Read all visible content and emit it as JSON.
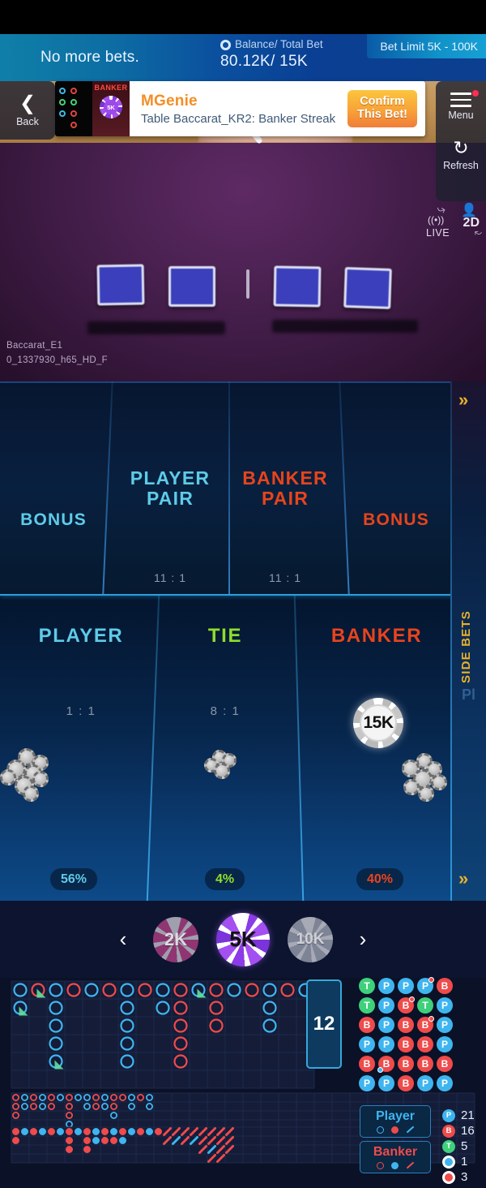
{
  "status": {
    "message": "No more bets.",
    "balance_label": "Balance/ Total Bet",
    "balance_value": "80.12K/ 15K",
    "bet_limit": "Bet Limit  5K - 100K"
  },
  "promo": {
    "title": "MGenie",
    "subtitle": "Table Baccarat_KR2: Banker Streak",
    "cta_line1": "Confirm",
    "cta_line2": "This Bet!",
    "thumb_badge": "BANKER",
    "thumb_chip": "5K"
  },
  "controls": {
    "back": "Back",
    "menu": "Menu",
    "refresh": "Refresh"
  },
  "video": {
    "stream_name": "Baccarat_E1",
    "stream_id": "0_1337930_h65_HD_F",
    "live": "LIVE",
    "view_mode": "2D"
  },
  "side_bets": {
    "tab_label": "SIDE BETS",
    "ghost_label": "Pl",
    "chevron": "»",
    "areas": [
      {
        "name": "BONUS",
        "color": "#5ecbe8",
        "odds": ""
      },
      {
        "name": "PLAYER\nPAIR",
        "color": "#5ecbe8",
        "odds": "11 : 1"
      },
      {
        "name": "BANKER\nPAIR",
        "color": "#e8441c",
        "odds": "11 : 1"
      },
      {
        "name": "BONUS",
        "color": "#e8441c",
        "odds": ""
      }
    ]
  },
  "main_bets": [
    {
      "name": "PLAYER",
      "color": "#5ecbe8",
      "odds": "1 : 1",
      "percent": "56%",
      "has_bet_chip": false
    },
    {
      "name": "TIE",
      "color": "#8ede2b",
      "odds": "8 : 1",
      "percent": "4%",
      "has_bet_chip": false
    },
    {
      "name": "BANKER",
      "color": "#e8441c",
      "odds": "",
      "percent": "40%",
      "has_bet_chip": true
    }
  ],
  "bet_chip": {
    "value": "15K"
  },
  "chip_selector": {
    "prev": "‹",
    "next": "›",
    "chips": [
      {
        "label": "2K",
        "selected": false,
        "style": "pink"
      },
      {
        "label": "5K",
        "selected": true,
        "style": "purple"
      },
      {
        "label": "10K",
        "selected": false,
        "style": "grey"
      }
    ]
  },
  "roadmaps": {
    "big_road_count": "12",
    "big_road": [
      {
        "col": 0,
        "row": 0,
        "t": "P"
      },
      {
        "col": 0,
        "row": 1,
        "t": "P",
        "bp": true
      },
      {
        "col": 1,
        "row": 0,
        "t": "B",
        "bp": true
      },
      {
        "col": 2,
        "row": 0,
        "t": "P"
      },
      {
        "col": 2,
        "row": 1,
        "t": "P"
      },
      {
        "col": 2,
        "row": 2,
        "t": "P"
      },
      {
        "col": 2,
        "row": 3,
        "t": "P"
      },
      {
        "col": 2,
        "row": 4,
        "t": "P",
        "bp": true
      },
      {
        "col": 3,
        "row": 0,
        "t": "B"
      },
      {
        "col": 4,
        "row": 0,
        "t": "P"
      },
      {
        "col": 5,
        "row": 0,
        "t": "B"
      },
      {
        "col": 6,
        "row": 0,
        "t": "P"
      },
      {
        "col": 6,
        "row": 1,
        "t": "P"
      },
      {
        "col": 6,
        "row": 2,
        "t": "P"
      },
      {
        "col": 6,
        "row": 3,
        "t": "P"
      },
      {
        "col": 6,
        "row": 4,
        "t": "P"
      },
      {
        "col": 7,
        "row": 0,
        "t": "B"
      },
      {
        "col": 8,
        "row": 0,
        "t": "P"
      },
      {
        "col": 8,
        "row": 1,
        "t": "P"
      },
      {
        "col": 9,
        "row": 0,
        "t": "B"
      },
      {
        "col": 9,
        "row": 1,
        "t": "B"
      },
      {
        "col": 9,
        "row": 2,
        "t": "B"
      },
      {
        "col": 9,
        "row": 3,
        "t": "B"
      },
      {
        "col": 9,
        "row": 4,
        "t": "B"
      },
      {
        "col": 10,
        "row": 0,
        "t": "P",
        "bp": true
      },
      {
        "col": 11,
        "row": 0,
        "t": "B"
      },
      {
        "col": 11,
        "row": 1,
        "t": "B"
      },
      {
        "col": 11,
        "row": 2,
        "t": "B"
      },
      {
        "col": 12,
        "row": 0,
        "t": "P"
      },
      {
        "col": 13,
        "row": 0,
        "t": "B"
      },
      {
        "col": 14,
        "row": 0,
        "t": "P"
      },
      {
        "col": 14,
        "row": 1,
        "t": "P"
      },
      {
        "col": 14,
        "row": 2,
        "t": "P"
      },
      {
        "col": 15,
        "row": 0,
        "t": "B"
      },
      {
        "col": 16,
        "row": 0,
        "t": "P"
      }
    ],
    "big_eye": [
      {
        "c": 0,
        "r": 0,
        "t": "B"
      },
      {
        "c": 0,
        "r": 1,
        "t": "B"
      },
      {
        "c": 0,
        "r": 2,
        "t": "B"
      },
      {
        "c": 1,
        "r": 0,
        "t": "P"
      },
      {
        "c": 1,
        "r": 1,
        "t": "P"
      },
      {
        "c": 2,
        "r": 0,
        "t": "B"
      },
      {
        "c": 2,
        "r": 1,
        "t": "B"
      },
      {
        "c": 3,
        "r": 0,
        "t": "P"
      },
      {
        "c": 3,
        "r": 1,
        "t": "P"
      },
      {
        "c": 4,
        "r": 0,
        "t": "B"
      },
      {
        "c": 4,
        "r": 1,
        "t": "B"
      },
      {
        "c": 5,
        "r": 0,
        "t": "P"
      },
      {
        "c": 6,
        "r": 0,
        "t": "B"
      },
      {
        "c": 6,
        "r": 1,
        "t": "B"
      },
      {
        "c": 6,
        "r": 2,
        "t": "B"
      },
      {
        "c": 6,
        "r": 3,
        "t": "P"
      },
      {
        "c": 7,
        "r": 0,
        "t": "P"
      },
      {
        "c": 8,
        "r": 0,
        "t": "P"
      },
      {
        "c": 8,
        "r": 1,
        "t": "P"
      },
      {
        "c": 9,
        "r": 0,
        "t": "B"
      },
      {
        "c": 9,
        "r": 1,
        "t": "B"
      },
      {
        "c": 10,
        "r": 0,
        "t": "P"
      },
      {
        "c": 10,
        "r": 1,
        "t": "P"
      },
      {
        "c": 11,
        "r": 0,
        "t": "B"
      },
      {
        "c": 11,
        "r": 1,
        "t": "B"
      },
      {
        "c": 11,
        "r": 2,
        "t": "P"
      },
      {
        "c": 12,
        "r": 0,
        "t": "B"
      },
      {
        "c": 13,
        "r": 0,
        "t": "P"
      },
      {
        "c": 13,
        "r": 1,
        "t": "P"
      },
      {
        "c": 14,
        "r": 0,
        "t": "B"
      },
      {
        "c": 15,
        "r": 0,
        "t": "P"
      },
      {
        "c": 15,
        "r": 1,
        "t": "P"
      }
    ],
    "small_road": [
      {
        "c": 0,
        "r": 0,
        "t": "B"
      },
      {
        "c": 0,
        "r": 1,
        "t": "B"
      },
      {
        "c": 1,
        "r": 0,
        "t": "P"
      },
      {
        "c": 2,
        "r": 0,
        "t": "B"
      },
      {
        "c": 3,
        "r": 0,
        "t": "P"
      },
      {
        "c": 4,
        "r": 0,
        "t": "B"
      },
      {
        "c": 5,
        "r": 0,
        "t": "P"
      },
      {
        "c": 6,
        "r": 0,
        "t": "B"
      },
      {
        "c": 6,
        "r": 1,
        "t": "B"
      },
      {
        "c": 6,
        "r": 2,
        "t": "B"
      },
      {
        "c": 7,
        "r": 0,
        "t": "P"
      },
      {
        "c": 8,
        "r": 0,
        "t": "B"
      },
      {
        "c": 8,
        "r": 1,
        "t": "B"
      },
      {
        "c": 8,
        "r": 2,
        "t": "B"
      },
      {
        "c": 9,
        "r": 0,
        "t": "P"
      },
      {
        "c": 9,
        "r": 1,
        "t": "P"
      },
      {
        "c": 10,
        "r": 0,
        "t": "B"
      },
      {
        "c": 10,
        "r": 1,
        "t": "B"
      },
      {
        "c": 11,
        "r": 0,
        "t": "P"
      },
      {
        "c": 11,
        "r": 1,
        "t": "B"
      },
      {
        "c": 12,
        "r": 0,
        "t": "B"
      },
      {
        "c": 12,
        "r": 1,
        "t": "P"
      },
      {
        "c": 13,
        "r": 0,
        "t": "P"
      },
      {
        "c": 14,
        "r": 0,
        "t": "B"
      },
      {
        "c": 15,
        "r": 0,
        "t": "P"
      },
      {
        "c": 16,
        "r": 0,
        "t": "B"
      },
      {
        "c": 17,
        "r": 0,
        "t": "B"
      },
      {
        "c": 17,
        "r": 1,
        "t": "B"
      },
      {
        "c": 18,
        "r": 0,
        "t": "B"
      },
      {
        "c": 18,
        "r": 1,
        "t": "P"
      },
      {
        "c": 19,
        "r": 0,
        "t": "B"
      },
      {
        "c": 19,
        "r": 1,
        "t": "B"
      },
      {
        "c": 20,
        "r": 0,
        "t": "B"
      },
      {
        "c": 20,
        "r": 1,
        "t": "P"
      },
      {
        "c": 21,
        "r": 0,
        "t": "B"
      },
      {
        "c": 21,
        "r": 1,
        "t": "B"
      },
      {
        "c": 21,
        "r": 2,
        "t": "B"
      },
      {
        "c": 22,
        "r": 0,
        "t": "B"
      },
      {
        "c": 22,
        "r": 1,
        "t": "B"
      },
      {
        "c": 22,
        "r": 2,
        "t": "P"
      },
      {
        "c": 22,
        "r": 3,
        "t": "B"
      },
      {
        "c": 23,
        "r": 0,
        "t": "B"
      },
      {
        "c": 23,
        "r": 1,
        "t": "B"
      },
      {
        "c": 23,
        "r": 2,
        "t": "B"
      },
      {
        "c": 23,
        "r": 3,
        "t": "B"
      },
      {
        "c": 24,
        "r": 0,
        "t": "B"
      },
      {
        "c": 24,
        "r": 1,
        "t": "B"
      },
      {
        "c": 24,
        "r": 2,
        "t": "B"
      }
    ],
    "bead_plate": [
      {
        "t": "T"
      },
      {
        "t": "P"
      },
      {
        "t": "P"
      },
      {
        "t": "P",
        "bp": true
      },
      {
        "t": "B"
      },
      {
        "t": "T"
      },
      {
        "t": "P"
      },
      {
        "t": "B",
        "bp": true
      },
      {
        "t": "T"
      },
      {
        "t": "P"
      },
      {
        "t": "B"
      },
      {
        "t": "P"
      },
      {
        "t": "B"
      },
      {
        "t": "B",
        "bp": true
      },
      {
        "t": "P"
      },
      {
        "t": "P"
      },
      {
        "t": "P"
      },
      {
        "t": "B"
      },
      {
        "t": "B"
      },
      {
        "t": "P"
      },
      {
        "t": "B"
      },
      {
        "t": "B",
        "pp": true
      },
      {
        "t": "B"
      },
      {
        "t": "B"
      },
      {
        "t": "B"
      },
      {
        "t": "P"
      },
      {
        "t": "P"
      },
      {
        "t": "B"
      },
      {
        "t": "P"
      },
      {
        "t": "P"
      }
    ]
  },
  "legend": {
    "player": {
      "label": "Player",
      "color": "#3fb5ef"
    },
    "banker": {
      "label": "Banker",
      "color": "#ef4b4b"
    }
  },
  "stats": [
    {
      "icon": "P",
      "bg": "#3fb5ef",
      "value": "21"
    },
    {
      "icon": "B",
      "bg": "#ef4b4b",
      "value": "16"
    },
    {
      "icon": "T",
      "bg": "#3ed07b",
      "value": "5"
    },
    {
      "icon": "pp",
      "bg": "#3fb5ef",
      "value": "1"
    },
    {
      "icon": "bp",
      "bg": "#ef4b4b",
      "value": "3"
    }
  ]
}
